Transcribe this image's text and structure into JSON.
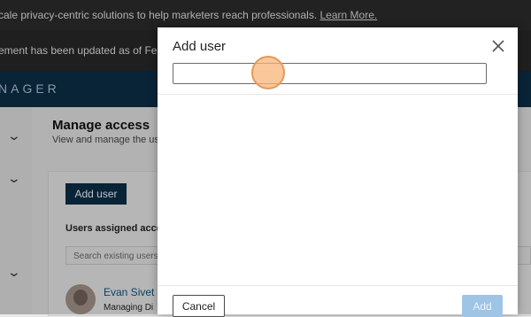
{
  "background": {
    "banner_message": "cale privacy-centric solutions to help marketers reach professionals.",
    "banner_link": "Learn More.",
    "notice_text": "ement has been updated as of Febru",
    "appbar_title": "NAGER",
    "page_title": "Manage access",
    "page_subtitle": "View and manage the us",
    "add_user_button": "Add user",
    "assigned_label": "Users assigned acce",
    "search_placeholder": "Search existing users",
    "user_name": "Evan Sivet",
    "user_role": "Managing Di"
  },
  "modal": {
    "title": "Add user",
    "input_value": "",
    "cancel_label": "Cancel",
    "add_label": "Add",
    "close_icon": "close-icon"
  },
  "colors": {
    "brand_navy": "#0b2b44",
    "add_disabled": "#9ec4e6",
    "link_blue": "#0b4f7c"
  }
}
